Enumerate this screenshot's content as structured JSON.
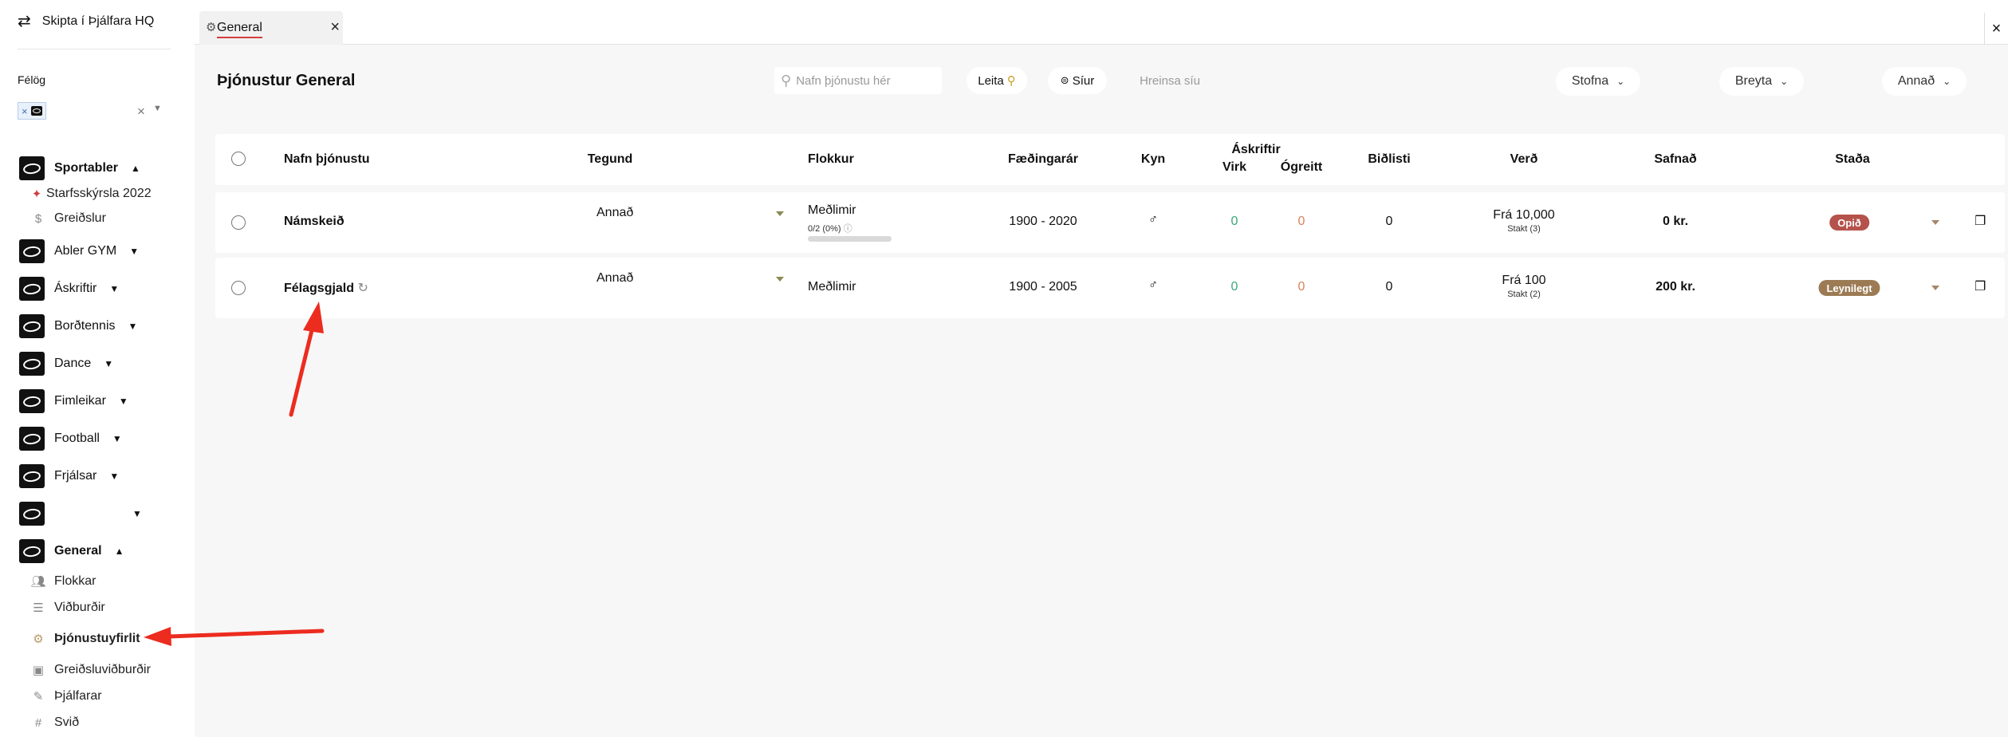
{
  "sidebar": {
    "switch_label": "Skipta í Þjálfara HQ",
    "felog_label": "Félög",
    "sports": [
      {
        "label": "Sportabler",
        "expanded": true
      },
      {
        "label": "Abler GYM",
        "expanded": false
      },
      {
        "label": "Áskriftir",
        "expanded": false
      },
      {
        "label": "Borðtennis",
        "expanded": false
      },
      {
        "label": "Dance",
        "expanded": false
      },
      {
        "label": "Fimleikar",
        "expanded": false
      },
      {
        "label": "Football",
        "expanded": false
      },
      {
        "label": "Frjálsar",
        "expanded": false
      },
      {
        "label": "",
        "expanded": false
      },
      {
        "label": "General",
        "expanded": true
      }
    ],
    "sportabler_sub": [
      "Starfsskýrsla 2022",
      "Greiðslur"
    ],
    "general_sub": [
      "Flokkar",
      "Viðburðir",
      "Þjónustuyfirlit",
      "Greiðsluviðburðir",
      "Þjálfarar",
      "Svið"
    ],
    "active_item": "Þjónustuyfirlit"
  },
  "tab": {
    "label": "General"
  },
  "header": {
    "title": "Þjónustur General",
    "search_placeholder": "Nafn þjónustu hér",
    "search_button": "Leita",
    "filter_button": "Síur",
    "clear_filter": "Hreinsa síu",
    "dropdowns": [
      "Stofna",
      "Breyta",
      "Annað"
    ]
  },
  "table": {
    "columns": {
      "name": "Nafn þjónustu",
      "type": "Tegund",
      "category": "Flokkur",
      "birth_years": "Fæðingarár",
      "gender": "Kyn",
      "subscriptions": "Áskriftir",
      "active": "Virk",
      "unpaid": "Ógreitt",
      "waitlist": "Biðlisti",
      "price": "Verð",
      "collected": "Safnað",
      "status": "Staða"
    },
    "rows": [
      {
        "name": "Námskeið",
        "type": "Annað",
        "category": "Meðlimir",
        "capacity": "0/2 (0%)",
        "birth_years": "1900 - 2020",
        "gender": "♂",
        "active": "0",
        "unpaid": "0",
        "waitlist": "0",
        "price": "Frá 10,000",
        "price_sub": "Stakt (3)",
        "collected": "0 kr.",
        "status": "Opið",
        "status_color": "#b5524b"
      },
      {
        "name": "Félagsgjald",
        "type": "Annað",
        "category": "Meðlimir",
        "birth_years": "1900 - 2005",
        "gender": "♂",
        "active": "0",
        "unpaid": "0",
        "waitlist": "0",
        "price": "Frá 100",
        "price_sub": "Stakt (2)",
        "collected": "200 kr.",
        "status": "Leynilegt",
        "status_color": "#9c7b54"
      }
    ]
  },
  "colors": {
    "accent_red": "#d43d3d",
    "active_green": "#3da87a",
    "unpaid_orange": "#d9825b",
    "arrow_red": "#ec2c1f"
  }
}
